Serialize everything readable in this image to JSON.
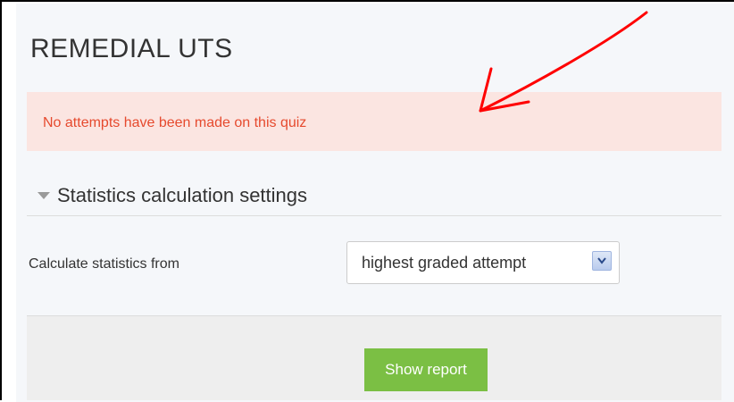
{
  "page": {
    "title": "REMEDIAL UTS"
  },
  "alert": {
    "message": "No attempts have been made on this quiz",
    "color": "#e64a2e",
    "background": "#fbe5e1"
  },
  "settings": {
    "section_title": "Statistics calculation settings",
    "calc_label": "Calculate statistics from",
    "calc_value": "highest graded attempt"
  },
  "actions": {
    "show_report_label": "Show report",
    "button_color": "#7bbf44"
  },
  "annotation": {
    "arrow_color": "#ff0000"
  }
}
